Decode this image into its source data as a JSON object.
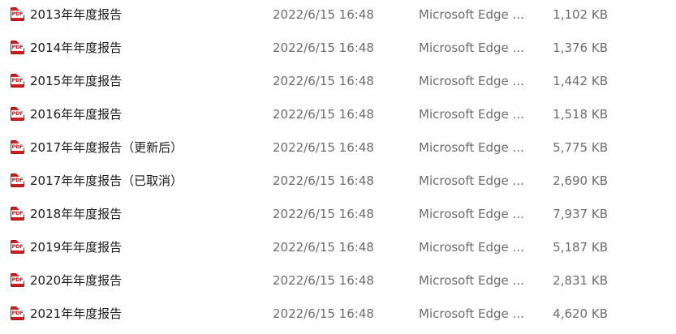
{
  "files": [
    {
      "name": "2013年年度报告",
      "date": "2022/6/15 16:48",
      "type": "Microsoft Edge ...",
      "size": "1,102 KB",
      "icon": "pdf-icon",
      "icon_label": "PDF"
    },
    {
      "name": "2014年年度报告",
      "date": "2022/6/15 16:48",
      "type": "Microsoft Edge ...",
      "size": "1,376 KB",
      "icon": "pdf-icon",
      "icon_label": "PDF"
    },
    {
      "name": "2015年年度报告",
      "date": "2022/6/15 16:48",
      "type": "Microsoft Edge ...",
      "size": "1,442 KB",
      "icon": "pdf-icon",
      "icon_label": "PDF"
    },
    {
      "name": "2016年年度报告",
      "date": "2022/6/15 16:48",
      "type": "Microsoft Edge ...",
      "size": "1,518 KB",
      "icon": "pdf-icon",
      "icon_label": "PDF"
    },
    {
      "name": "2017年年度报告（更新后）",
      "date": "2022/6/15 16:48",
      "type": "Microsoft Edge ...",
      "size": "5,775 KB",
      "icon": "pdf-icon",
      "icon_label": "PDF"
    },
    {
      "name": "2017年年度报告（已取消）",
      "date": "2022/6/15 16:48",
      "type": "Microsoft Edge ...",
      "size": "2,690 KB",
      "icon": "pdf-icon",
      "icon_label": "PDF"
    },
    {
      "name": "2018年年度报告",
      "date": "2022/6/15 16:48",
      "type": "Microsoft Edge ...",
      "size": "7,937 KB",
      "icon": "pdf-icon",
      "icon_label": "PDF"
    },
    {
      "name": "2019年年度报告",
      "date": "2022/6/15 16:48",
      "type": "Microsoft Edge ...",
      "size": "5,187 KB",
      "icon": "pdf-icon",
      "icon_label": "PDF"
    },
    {
      "name": "2020年年度报告",
      "date": "2022/6/15 16:48",
      "type": "Microsoft Edge ...",
      "size": "2,831 KB",
      "icon": "pdf-icon",
      "icon_label": "PDF"
    },
    {
      "name": "2021年年度报告",
      "date": "2022/6/15 16:48",
      "type": "Microsoft Edge ...",
      "size": "4,620 KB",
      "icon": "pdf-icon",
      "icon_label": "PDF"
    }
  ],
  "colors": {
    "pdf_red": "#cc1f1f",
    "name_text": "#1a1a1a",
    "detail_text": "#6d6d6d"
  }
}
